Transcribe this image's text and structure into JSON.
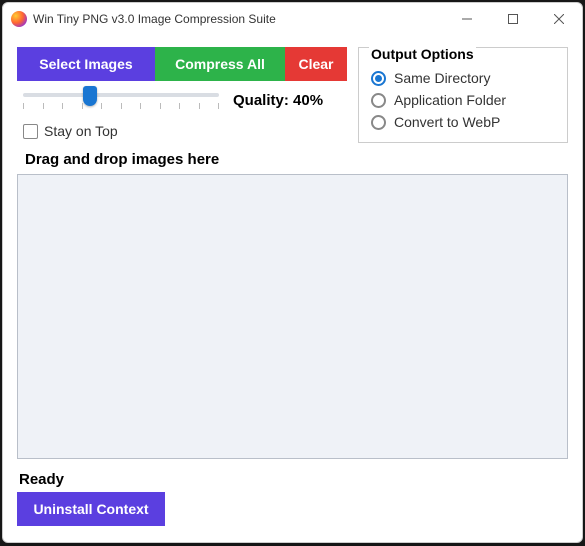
{
  "window": {
    "title": "Win Tiny PNG v3.0 Image Compression Suite"
  },
  "buttons": {
    "select": "Select Images",
    "compress": "Compress All",
    "clear": "Clear",
    "uninstall": "Uninstall Context"
  },
  "quality": {
    "label": "Quality: 40%",
    "value": 40
  },
  "stay_on_top": {
    "label": "Stay on Top",
    "checked": false
  },
  "output": {
    "title": "Output Options",
    "options": [
      {
        "label": "Same Directory",
        "checked": true
      },
      {
        "label": "Application Folder",
        "checked": false
      },
      {
        "label": "Convert to WebP",
        "checked": false
      }
    ]
  },
  "drag_label": "Drag and drop images here",
  "status": "Ready"
}
